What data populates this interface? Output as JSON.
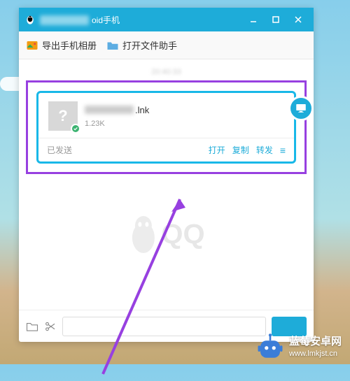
{
  "titlebar": {
    "title_suffix": "oid手机"
  },
  "toolbar": {
    "export_album": "导出手机相册",
    "open_file_helper": "打开文件助手"
  },
  "chat": {
    "timestamp": "20:40:33",
    "file": {
      "name_suffix": ".lnk",
      "size": "1.23K"
    },
    "status": "已发送",
    "actions": {
      "open": "打开",
      "copy": "复制",
      "forward": "转发"
    }
  },
  "watermark": {
    "letters": "QQ"
  },
  "footer": {
    "title": "蓝莓安卓网",
    "url": "www.lmkjst.cn"
  }
}
